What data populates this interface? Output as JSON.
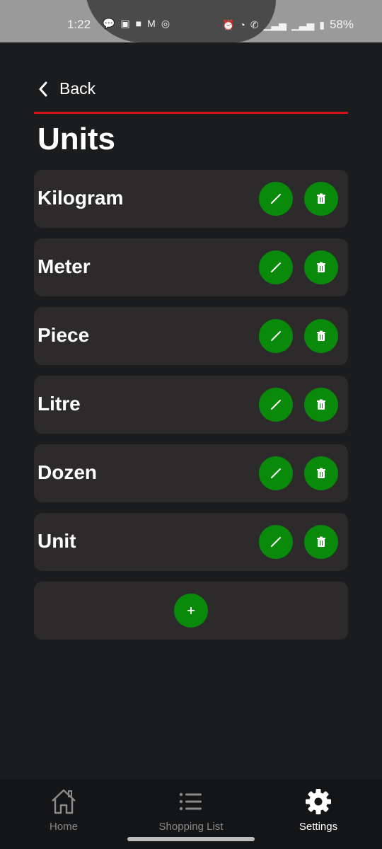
{
  "status_bar": {
    "time": "1:22",
    "left_icons": [
      "chat-icon",
      "instagram-icon",
      "linkedin-icon",
      "gmail-icon",
      "app-icon"
    ],
    "right_icons": [
      "alarm-icon",
      "wifi-icon",
      "wifi-call-icon",
      "signal-icon",
      "signal-icon"
    ],
    "battery": "58%"
  },
  "header": {
    "back_label": "Back",
    "title": "Units"
  },
  "units": [
    {
      "name": "Kilogram"
    },
    {
      "name": "Meter"
    },
    {
      "name": "Piece"
    },
    {
      "name": "Litre"
    },
    {
      "name": "Dozen"
    },
    {
      "name": "Unit"
    }
  ],
  "add_button": {
    "icon": "plus-icon"
  },
  "bottom_nav": {
    "items": [
      {
        "label": "Home",
        "icon": "home-icon",
        "active": false
      },
      {
        "label": "Shopping List",
        "icon": "list-icon",
        "active": false
      },
      {
        "label": "Settings",
        "icon": "gear-icon",
        "active": true
      }
    ]
  },
  "colors": {
    "background": "#1a1c1e",
    "card": "#2c2a2b",
    "accent_green": "#0a8a0a",
    "divider_red": "#d81111"
  }
}
